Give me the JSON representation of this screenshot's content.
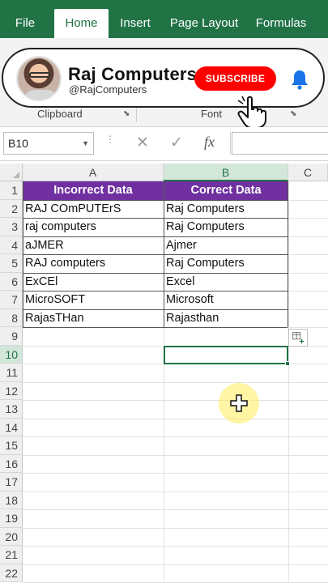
{
  "ribbon": {
    "tabs": [
      {
        "label": "File"
      },
      {
        "label": "Home",
        "active": true
      },
      {
        "label": "Insert"
      },
      {
        "label": "Page Layout"
      },
      {
        "label": "Formulas"
      }
    ],
    "groups": [
      {
        "label": "Clipboard"
      },
      {
        "label": "Font"
      }
    ],
    "accent_color": "#217346"
  },
  "channel": {
    "name": "Raj Computers",
    "handle": "@RajComputers",
    "subscribe_label": "SUBSCRIBE",
    "subscribe_color": "#ff0000",
    "bell_icon": "bell-icon",
    "bell_color": "#1a73e8"
  },
  "formula_bar": {
    "name_box": "B10",
    "cancel_icon": "✕",
    "enter_icon": "✓",
    "fx_label": "fx",
    "value": ""
  },
  "sheet": {
    "columns": [
      "A",
      "B",
      "C"
    ],
    "selected_column": "B",
    "rows": [
      "1",
      "2",
      "3",
      "4",
      "5",
      "6",
      "7",
      "8",
      "9",
      "10",
      "11",
      "12",
      "13",
      "14",
      "15",
      "16",
      "17",
      "18",
      "19",
      "20",
      "21",
      "22"
    ],
    "selected_row": "10",
    "active_cell": "B10",
    "header_color": "#7030a0",
    "table": {
      "headers": [
        "Incorrect Data",
        "Correct Data"
      ],
      "rows": [
        [
          "RAJ COmPUTErS",
          "Raj Computers"
        ],
        [
          "raj computers",
          "Raj Computers"
        ],
        [
          "aJMER",
          "Ajmer"
        ],
        [
          "RAJ computers",
          "Raj Computers"
        ],
        [
          "ExCEl",
          "Excel"
        ],
        [
          "MicroSOFT",
          "Microsoft"
        ],
        [
          "RajasTHan",
          "Rajasthan"
        ]
      ]
    }
  }
}
